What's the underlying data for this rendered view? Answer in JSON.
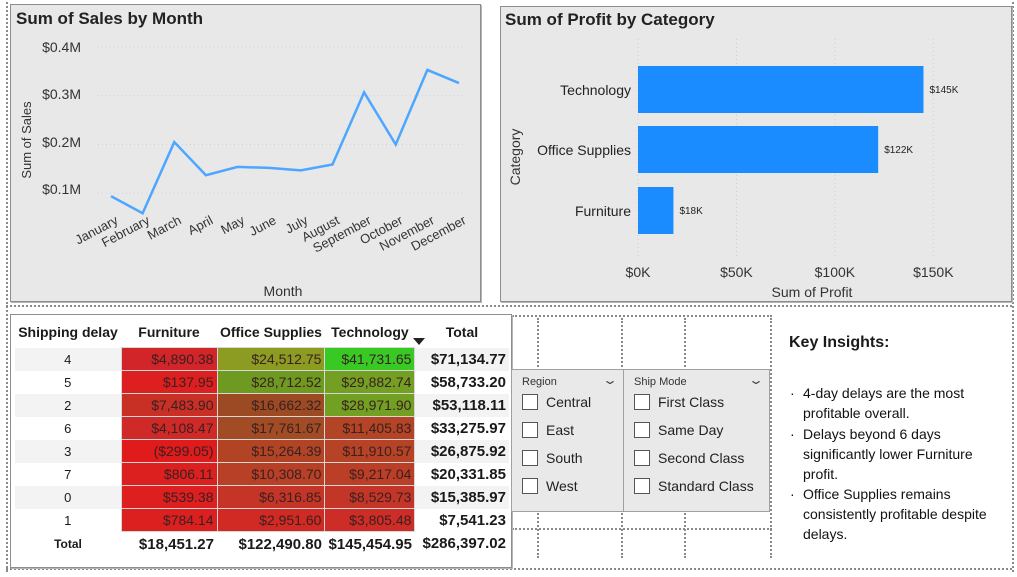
{
  "sales_chart": {
    "title": "Sum of Sales by Month",
    "y_ticks": [
      "$0.4M",
      "$0.3M",
      "$0.2M",
      "$0.1M"
    ],
    "ylabel": "Sum of Sales",
    "xlabel": "Month",
    "color": "#4da6ff"
  },
  "profit_chart": {
    "title": "Sum of Profit by Category",
    "ylabel": "Category",
    "xlabel": "Sum of Profit",
    "x_ticks": [
      "$0K",
      "$50K",
      "$100K",
      "$150K"
    ],
    "color": "#1a8cff"
  },
  "chart_data": [
    {
      "type": "line",
      "title": "Sum of Sales by Month",
      "xlabel": "Month",
      "ylabel": "Sum of Sales",
      "categories": [
        "January",
        "February",
        "March",
        "April",
        "May",
        "June",
        "July",
        "August",
        "September",
        "October",
        "November",
        "December"
      ],
      "values": [
        94000,
        59000,
        205000,
        137000,
        154000,
        152000,
        147000,
        159000,
        307000,
        200000,
        353000,
        326000
      ],
      "ylim": [
        0,
        400000
      ],
      "grid": true
    },
    {
      "type": "bar",
      "orientation": "horizontal",
      "title": "Sum of Profit by Category",
      "xlabel": "Sum of Profit",
      "ylabel": "Category",
      "categories": [
        "Technology",
        "Office Supplies",
        "Furniture"
      ],
      "values": [
        145000,
        122000,
        18000
      ],
      "data_labels": [
        "$145K",
        "$122K",
        "$18K"
      ],
      "xlim": [
        0,
        160000
      ],
      "grid": true
    }
  ],
  "matrix": {
    "headers": [
      "Shipping delay",
      "Furniture",
      "Office Supplies",
      "Technology",
      "Total"
    ],
    "rows": [
      {
        "delay": "4",
        "furniture": "$4,890.38",
        "office": "$24,512.75",
        "tech": "$41,731.65",
        "total": "$71,134.77",
        "colors": [
          "#d2252a",
          "#8c9b21",
          "#38c924"
        ]
      },
      {
        "delay": "5",
        "furniture": "$137.95",
        "office": "$28,712.52",
        "tech": "$29,882.74",
        "total": "$58,733.20",
        "colors": [
          "#dd1f1f",
          "#6e9a22",
          "#73a023"
        ]
      },
      {
        "delay": "2",
        "furniture": "$7,483.90",
        "office": "$16,662.32",
        "tech": "$28,971.90",
        "total": "$53,118.11",
        "colors": [
          "#c83026",
          "#9c4a24",
          "#72a023"
        ]
      },
      {
        "delay": "6",
        "furniture": "$4,108.47",
        "office": "$17,761.67",
        "tech": "$11,405.83",
        "total": "$33,275.97",
        "colors": [
          "#cf2a27",
          "#a14c25",
          "#b34426"
        ]
      },
      {
        "delay": "3",
        "furniture": "($299.05)",
        "office": "$15,264.39",
        "tech": "$11,910.57",
        "total": "$26,875.92",
        "colors": [
          "#e01b1b",
          "#b24426",
          "#b64326"
        ]
      },
      {
        "delay": "7",
        "furniture": "$806.11",
        "office": "$10,308.70",
        "tech": "$9,217.04",
        "total": "$20,331.85",
        "colors": [
          "#dc2020",
          "#b74026",
          "#bb3e26"
        ]
      },
      {
        "delay": "0",
        "furniture": "$539.38",
        "office": "$6,316.85",
        "tech": "$8,529.73",
        "total": "$15,385.97",
        "colors": [
          "#dd1f1f",
          "#c43527",
          "#c33627"
        ]
      },
      {
        "delay": "1",
        "furniture": "$784.14",
        "office": "$2,951.60",
        "tech": "$3,805.48",
        "total": "$7,541.23",
        "colors": [
          "#dc2020",
          "#d12a25",
          "#cd2d26"
        ]
      }
    ],
    "total_row": {
      "label": "Total",
      "furniture": "$18,451.27",
      "office": "$122,490.80",
      "tech": "$145,454.95",
      "total": "$286,397.02"
    }
  },
  "region_slicer": {
    "header": "Region",
    "items": [
      "Central",
      "East",
      "South",
      "West"
    ]
  },
  "shipmode_slicer": {
    "header": "Ship Mode",
    "items": [
      "First Class",
      "Same Day",
      "Second Class",
      "Standard Class"
    ]
  },
  "insights": {
    "title": "Key Insights:",
    "items": [
      "4-day delays are the most profitable overall.",
      "Delays beyond 6 days significantly lower Furniture profit.",
      "Office Supplies remains consistently profitable despite delays."
    ]
  }
}
